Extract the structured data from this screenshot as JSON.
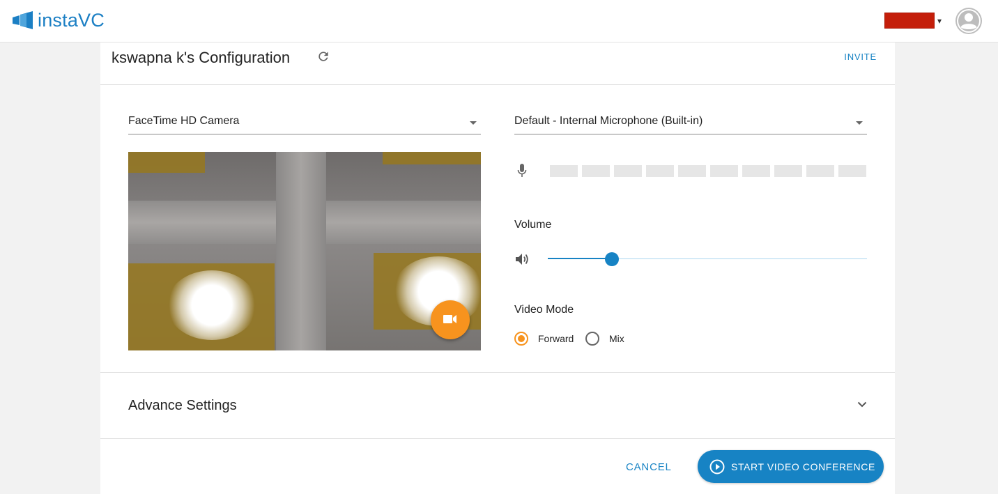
{
  "app": {
    "name": "instaVC",
    "brand_color": "#1b7fc4"
  },
  "header": {
    "user_menu_caret": "▾",
    "avatar_icon": "account-circle-icon"
  },
  "config": {
    "title": "kswapna k's Configuration",
    "refresh_icon": "refresh-icon",
    "invite_label": "INVITE"
  },
  "devices": {
    "camera": {
      "selected": "FaceTime HD Camera"
    },
    "microphone": {
      "selected": "Default - Internal Microphone (Built-in)"
    },
    "mic_level_segments": 10,
    "mic_level_active": 0
  },
  "volume": {
    "label": "Volume",
    "value_percent": 20,
    "icon": "speaker-icon"
  },
  "video_mode": {
    "label": "Video Mode",
    "options": [
      {
        "label": "Forward",
        "checked": true
      },
      {
        "label": "Mix",
        "checked": false
      }
    ]
  },
  "advance": {
    "title": "Advance Settings",
    "icon": "chevron-down-icon"
  },
  "actions": {
    "cancel_label": "CANCEL",
    "start_label": "START VIDEO CONFERENCE"
  },
  "colors": {
    "accent": "#1783c4",
    "orange": "#f7931e",
    "user_chip": "#c41e0a"
  }
}
